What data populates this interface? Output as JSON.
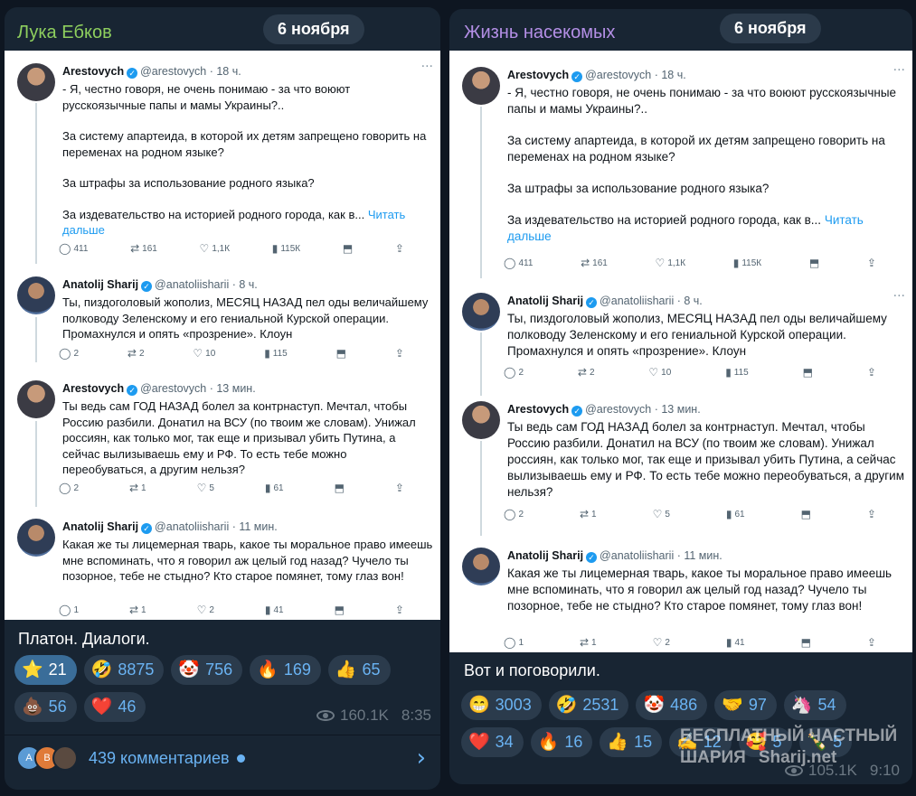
{
  "posts": [
    {
      "channel": "Лука Ебков",
      "date": "6 ноября",
      "tweets": [
        {
          "author": "Arestovych",
          "handle": "@arestovych",
          "time": "18 ч.",
          "paragraphs": [
            "- Я, честно говоря, не очень понимаю - за что воюют русскоязычные папы и мамы Украины?..",
            "За систему апартеида, в которой их детям запрещено говорить на переменах на родном языке?",
            "За штрафы за использование родного языка?",
            "За издевательство на историей родного города, как в..."
          ],
          "more": "Читать дальше",
          "stats": {
            "replies": "411",
            "retweets": "161",
            "likes": "1,1К",
            "views": "115К"
          }
        },
        {
          "author": "Anatolij Sharij",
          "handle": "@anatoliisharii",
          "time": "8 ч.",
          "paragraphs": [
            "Ты, пиздоголовый жополиз, МЕСЯЦ НАЗАД пел оды величайшему полководу Зеленскому и его гениальной Курской операции. Промахнулся и опять «прозрение». Клоун"
          ],
          "stats": {
            "replies": "2",
            "retweets": "2",
            "likes": "10",
            "views": "115"
          }
        },
        {
          "author": "Arestovych",
          "handle": "@arestovych",
          "time": "13 мин.",
          "paragraphs": [
            "Ты ведь сам ГОД НАЗАД болел за контрнаступ. Мечтал, чтобы Россию разбили. Донатил на ВСУ (по твоим же словам). Унижал россиян, как только мог, так еще и призывал убить Путина, а сейчас вылизываешь ему и РФ. То есть тебе можно переобуваться, а другим нельзя?"
          ],
          "stats": {
            "replies": "2",
            "retweets": "1",
            "likes": "5",
            "views": "61"
          }
        },
        {
          "author": "Anatolij Sharij",
          "handle": "@anatoliisharii",
          "time": "11 мин.",
          "paragraphs": [
            "Какая же ты лицемерная тварь, какое ты моральное право имеешь мне вспоминать, что я говорил аж целый год назад? Чучело ты позорное, тебе не стыдно? Кто старое помянет, тому глаз вон!"
          ],
          "stats": {
            "replies": "1",
            "retweets": "1",
            "likes": "2",
            "views": "41"
          }
        }
      ],
      "caption": "Платон. Диалоги.",
      "reactions": [
        {
          "emoji": "⭐",
          "count": "21",
          "mine": true
        },
        {
          "emoji": "🤣",
          "count": "8875"
        },
        {
          "emoji": "🤡",
          "count": "756"
        },
        {
          "emoji": "🔥",
          "count": "169"
        },
        {
          "emoji": "👍",
          "count": "65"
        },
        {
          "emoji": "💩",
          "count": "56"
        },
        {
          "emoji": "❤️",
          "count": "46"
        }
      ],
      "views": "160.1K",
      "time": "8:35",
      "comments": {
        "avatars": [
          "A",
          "B",
          ""
        ],
        "label": "439 комментариев"
      }
    },
    {
      "channel": "Жизнь насекомых",
      "date": "6 ноября",
      "caption": "Вот и поговорили.",
      "reactions": [
        {
          "emoji": "😁",
          "count": "3003"
        },
        {
          "emoji": "🤣",
          "count": "2531"
        },
        {
          "emoji": "🤡",
          "count": "486"
        },
        {
          "emoji": "🤝",
          "count": "97"
        },
        {
          "emoji": "🦄",
          "count": "54"
        },
        {
          "emoji": "❤️",
          "count": "34"
        },
        {
          "emoji": "🔥",
          "count": "16"
        },
        {
          "emoji": "👍",
          "count": "15"
        },
        {
          "emoji": "✍️",
          "count": "12"
        },
        {
          "emoji": "🥰",
          "count": "5"
        },
        {
          "emoji": "🍾",
          "count": "5"
        }
      ],
      "views": "105.1K",
      "time": "9:10"
    }
  ],
  "watermark": {
    "line1": "БЕСПЛАТНЫЙ ЧАСТНЫЙ",
    "line2a": "ШАРИЯ",
    "line2b": "Sharij.net"
  }
}
